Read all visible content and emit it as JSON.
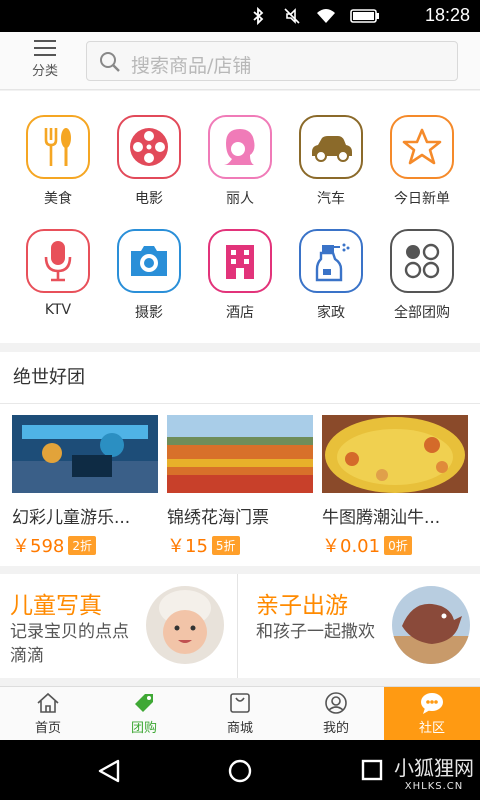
{
  "status_bar": {
    "time": "18:28",
    "icons": [
      "bluetooth-icon",
      "mute-icon",
      "wifi-icon",
      "battery-icon"
    ]
  },
  "header": {
    "category_label": "分类",
    "search_placeholder": "搜索商品/店铺"
  },
  "categories": [
    {
      "label": "美食",
      "icon": "food-icon",
      "color": "#f5a623"
    },
    {
      "label": "电影",
      "icon": "film-reel-icon",
      "color": "#e24a5a"
    },
    {
      "label": "丽人",
      "icon": "beauty-icon",
      "color": "#f07bb8"
    },
    {
      "label": "汽车",
      "icon": "car-icon",
      "color": "#8b6a2a"
    },
    {
      "label": "今日新单",
      "icon": "star-icon",
      "color": "#f58a2a"
    },
    {
      "label": "KTV",
      "icon": "microphone-icon",
      "color": "#e8505a"
    },
    {
      "label": "摄影",
      "icon": "camera-icon",
      "color": "#2a8fd8"
    },
    {
      "label": "酒店",
      "icon": "hotel-icon",
      "color": "#e2337a"
    },
    {
      "label": "家政",
      "icon": "spray-icon",
      "color": "#3a73c8"
    },
    {
      "label": "全部团购",
      "icon": "all-icon",
      "color": "#555555"
    }
  ],
  "deals": {
    "title": "绝世好团",
    "items": [
      {
        "name": "幻彩儿童游乐...",
        "price": "￥598",
        "discount": "2折"
      },
      {
        "name": "锦绣花海门票",
        "price": "￥15",
        "discount": "5折"
      },
      {
        "name": "牛图腾潮汕牛...",
        "price": "￥0.01",
        "discount": "0折"
      }
    ]
  },
  "promos": [
    {
      "title": "儿童写真",
      "subtitle": "记录宝贝的点点滴滴"
    },
    {
      "title": "亲子出游",
      "subtitle": "和孩子一起撒欢"
    }
  ],
  "tabs": [
    {
      "label": "首页",
      "icon": "home-icon"
    },
    {
      "label": "团购",
      "icon": "tag-icon"
    },
    {
      "label": "商城",
      "icon": "bag-icon"
    },
    {
      "label": "我的",
      "icon": "user-icon"
    },
    {
      "label": "社区",
      "icon": "chat-icon"
    }
  ],
  "watermark": {
    "line1": "小狐狸网",
    "line2": "XHLKS.CN"
  }
}
